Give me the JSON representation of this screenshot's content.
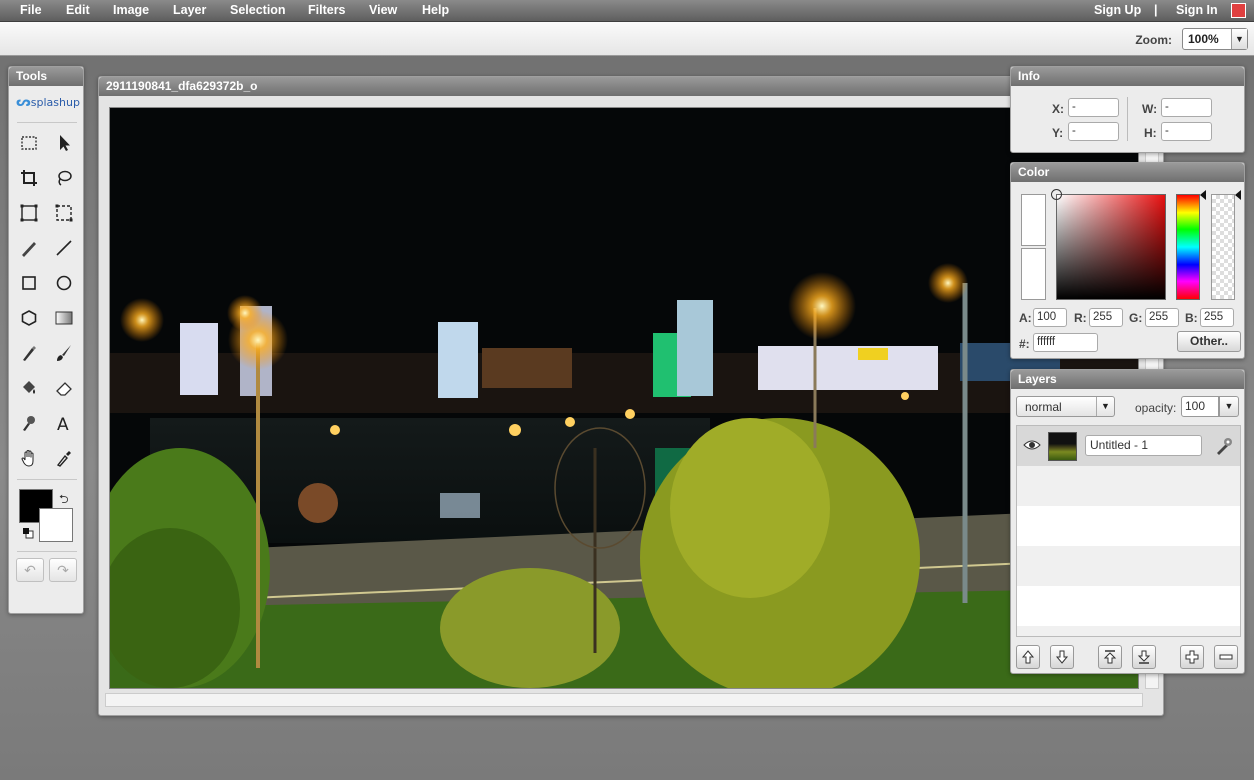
{
  "menu": {
    "items": [
      "File",
      "Edit",
      "Image",
      "Layer",
      "Selection",
      "Filters",
      "View",
      "Help"
    ],
    "sign_up": "Sign Up",
    "separator": "|",
    "sign_in": "Sign In"
  },
  "options_bar": {
    "zoom_label": "Zoom:",
    "zoom_value": "100%"
  },
  "tools_panel": {
    "title": "Tools",
    "logo_text": "splashup",
    "foreground_color": "#000000",
    "background_color": "#ffffff"
  },
  "document": {
    "title": "2911190841_dfa629372b_o"
  },
  "info_panel": {
    "title": "Info",
    "x_label": "X:",
    "x_value": "-",
    "y_label": "Y:",
    "y_value": "-",
    "w_label": "W:",
    "w_value": "-",
    "h_label": "H:",
    "h_value": "-"
  },
  "color_panel": {
    "title": "Color",
    "a_label": "A:",
    "a_value": "100",
    "r_label": "R:",
    "r_value": "255",
    "g_label": "G:",
    "g_value": "255",
    "b_label": "B:",
    "b_value": "255",
    "hex_label": "#:",
    "hex_value": "ffffff",
    "other_button": "Other.."
  },
  "layers_panel": {
    "title": "Layers",
    "blend_mode": "normal",
    "opacity_label": "opacity:",
    "opacity_value": "100",
    "layers": [
      {
        "name": "Untitled - 1",
        "visible": true
      }
    ]
  }
}
